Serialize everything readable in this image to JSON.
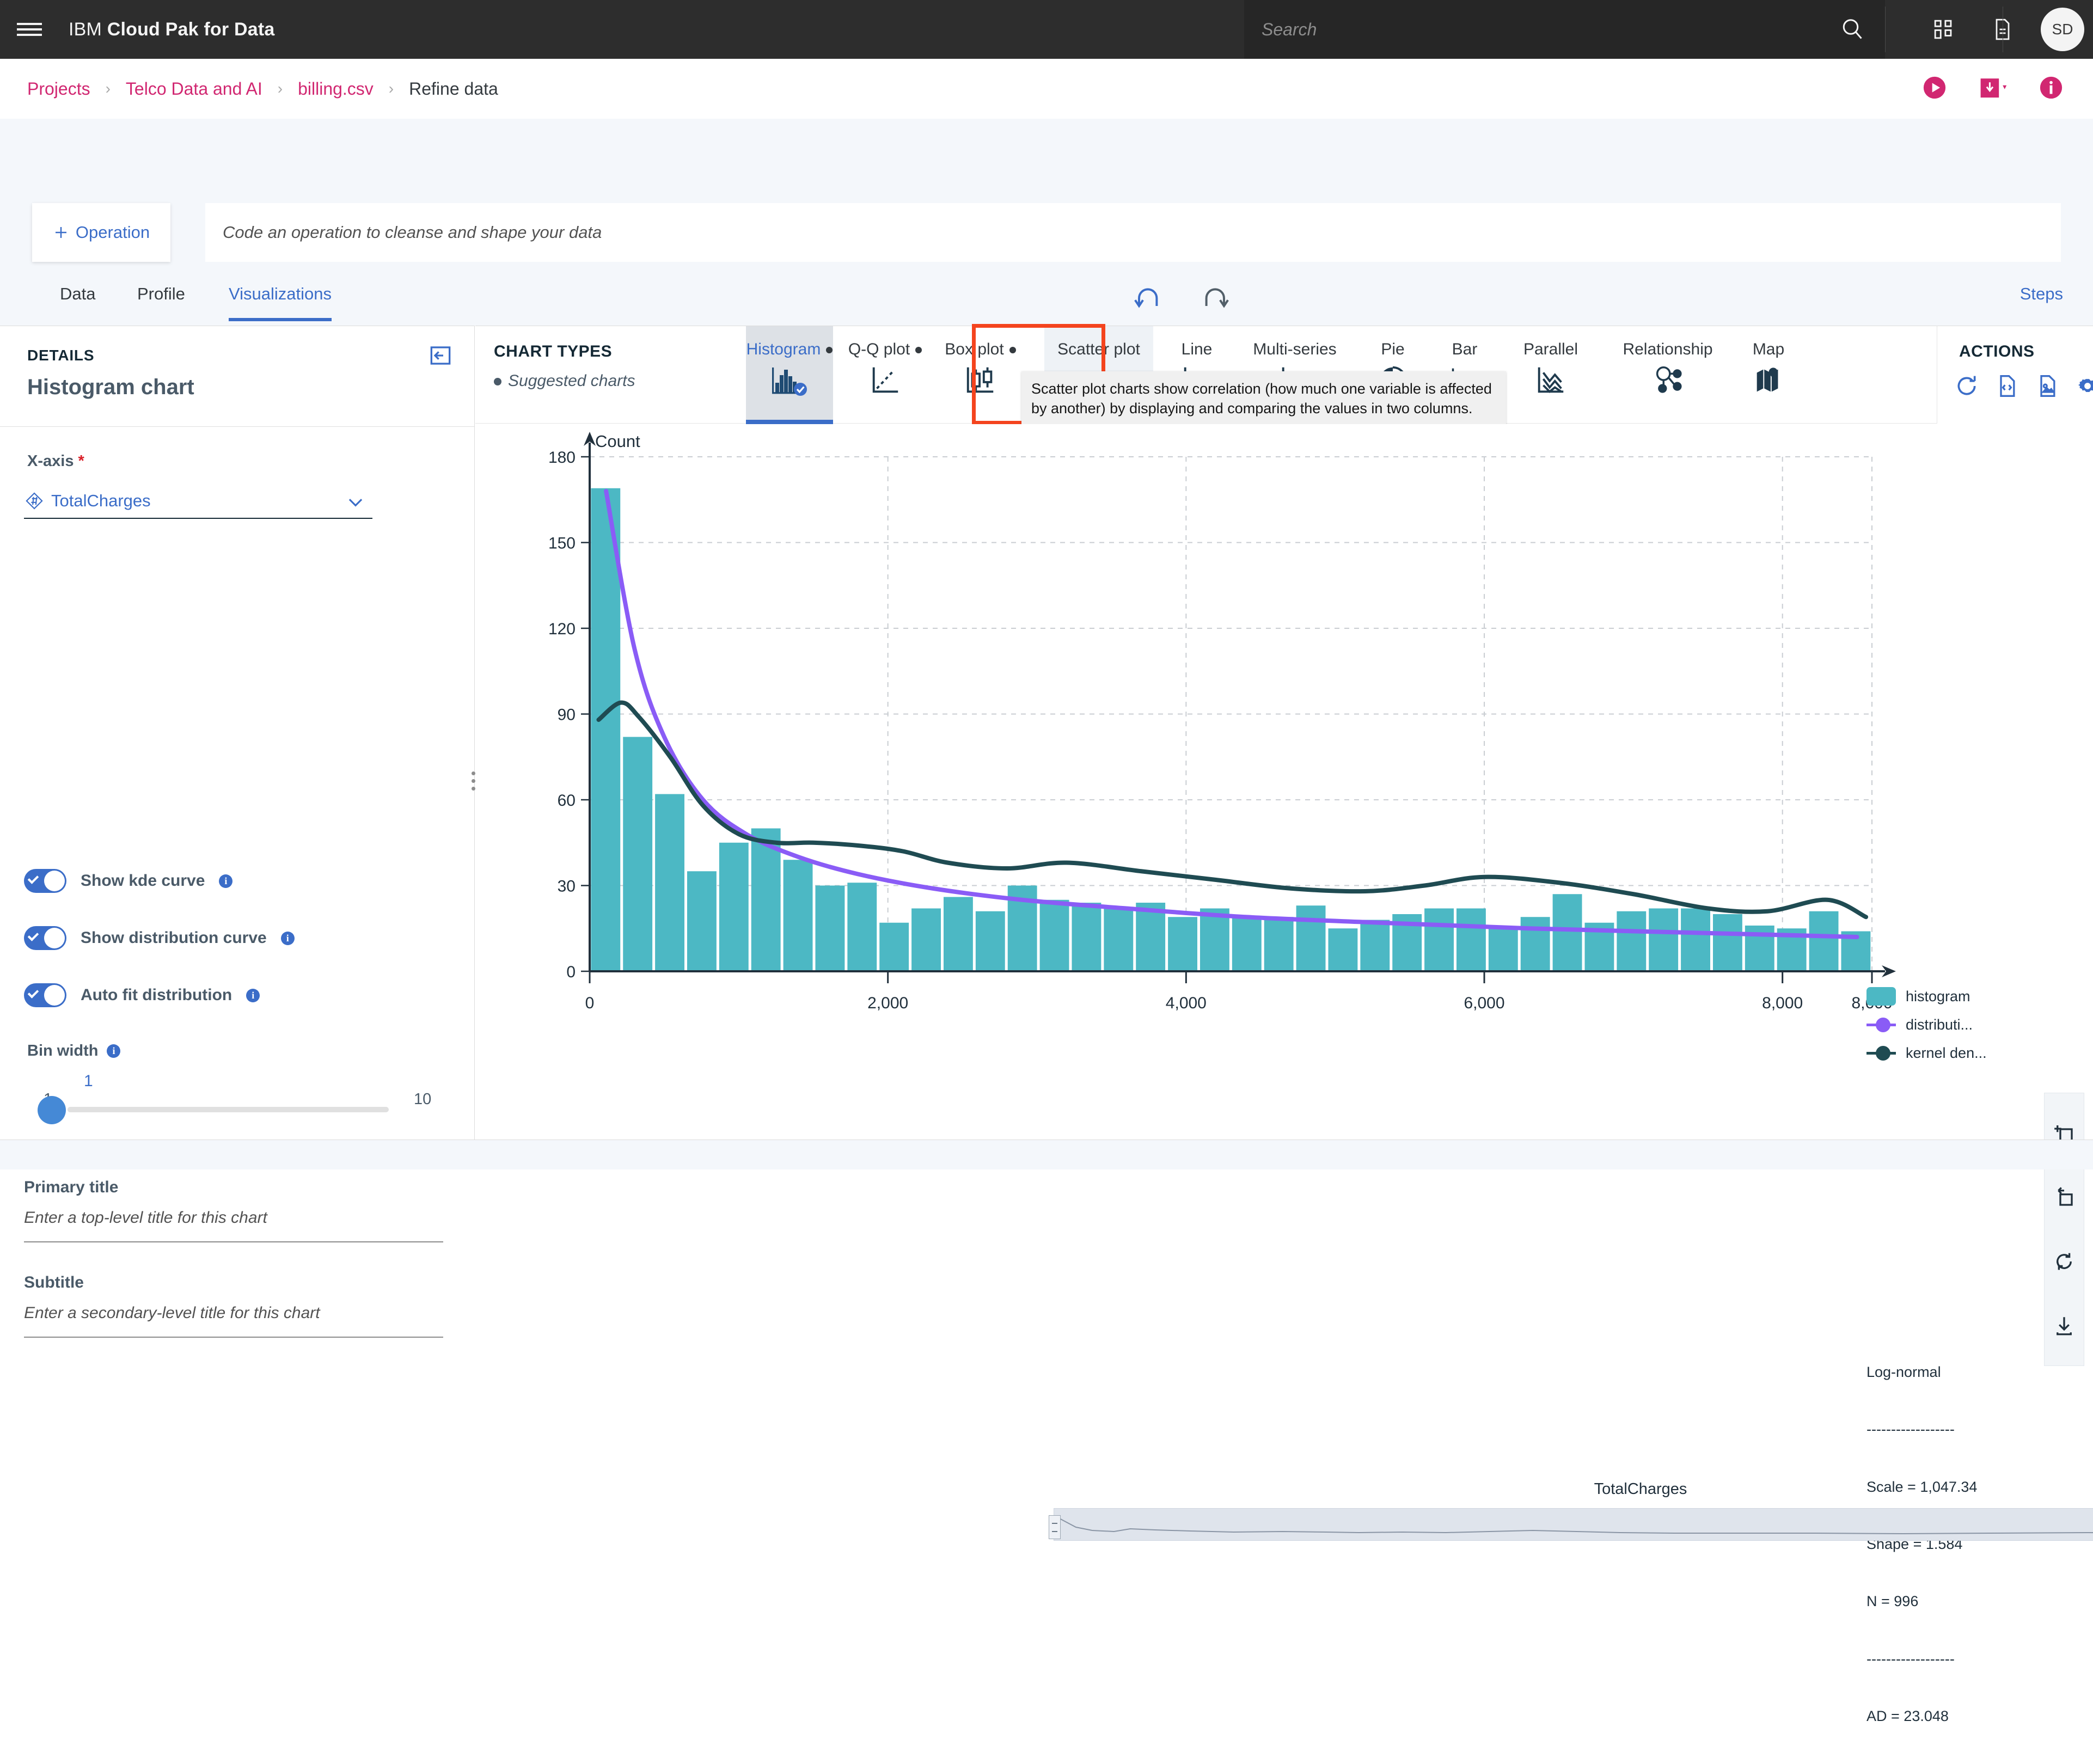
{
  "topbar": {
    "brand_prefix": "IBM",
    "brand_name": "Cloud Pak for Data",
    "search_placeholder": "Search",
    "avatar_initials": "SD",
    "icons": [
      "menu-icon",
      "search-icon",
      "apps-grid-icon",
      "document-icon"
    ]
  },
  "breadcrumb": {
    "items": [
      "Projects",
      "Telco Data and AI",
      "billing.csv",
      "Refine data"
    ],
    "separator": "›",
    "actions": [
      "run-icon",
      "save-dropdown-icon",
      "info-icon"
    ]
  },
  "operation": {
    "add_label": "Operation",
    "code_placeholder": "Code an operation to cleanse and shape your data"
  },
  "tabs": {
    "items": [
      "Data",
      "Profile",
      "Visualizations"
    ],
    "active": "Visualizations",
    "steps_label": "Steps",
    "undo_label": "undo-icon",
    "redo_label": "redo-icon"
  },
  "details": {
    "header_kicker": "DETAILS",
    "title": "Histogram chart",
    "collapse_icon": "collapse-panel-icon",
    "xaxis_label": "X-axis",
    "xaxis_required": "*",
    "xaxis_value": "TotalCharges",
    "toggles": [
      {
        "label": "Show kde curve",
        "on": true
      },
      {
        "label": "Show distribution curve",
        "on": true
      },
      {
        "label": "Auto fit distribution",
        "on": true
      }
    ],
    "bin_width_label": "Bin width",
    "bin_width_min": "1",
    "bin_width_max": "10",
    "bin_width_value": "1",
    "primary_title_label": "Primary title",
    "primary_title_placeholder": "Enter a top-level title for this chart",
    "subtitle_label": "Subtitle",
    "subtitle_placeholder": "Enter a secondary-level title for this chart"
  },
  "chart_types": {
    "title": "CHART TYPES",
    "suggested_label": "Suggested charts",
    "items": [
      {
        "label": "Histogram",
        "suggested": true,
        "state": "selected"
      },
      {
        "label": "Q-Q plot",
        "suggested": true,
        "state": "normal"
      },
      {
        "label": "Box plot",
        "suggested": true,
        "state": "normal"
      },
      {
        "label": "Scatter plot",
        "suggested": false,
        "state": "highlighted"
      },
      {
        "label": "Line",
        "suggested": false,
        "state": "normal"
      },
      {
        "label": "Multi-series",
        "suggested": false,
        "state": "normal"
      },
      {
        "label": "Pie",
        "suggested": false,
        "state": "normal"
      },
      {
        "label": "Bar",
        "suggested": false,
        "state": "normal"
      },
      {
        "label": "Parallel",
        "suggested": false,
        "state": "normal"
      },
      {
        "label": "Relationship",
        "suggested": false,
        "state": "normal"
      },
      {
        "label": "Map",
        "suggested": false,
        "state": "normal"
      }
    ],
    "overflow_icon": "chevron-double-down-icon",
    "tooltip": "Scatter plot charts show correlation (how much one variable is affected by another) by displaying and comparing the values in two columns."
  },
  "actions": {
    "title": "ACTIONS",
    "icons": [
      "refresh-icon",
      "code-file-icon",
      "image-file-icon",
      "gear-icon"
    ]
  },
  "side_tools": {
    "icons": [
      "add-selection-icon",
      "undo-selection-icon",
      "reset-zoom-icon",
      "download-icon"
    ]
  },
  "chart_data": {
    "type": "bar",
    "title": "",
    "xlabel": "TotalCharges",
    "ylabel": "Count",
    "xlim": [
      0,
      8600
    ],
    "ylim": [
      0,
      180
    ],
    "yticks": [
      0,
      30,
      60,
      90,
      120,
      150,
      180
    ],
    "xticks": [
      0,
      2000,
      4000,
      6000,
      8000,
      8600
    ],
    "xticklabels": [
      "0",
      "2,000",
      "4,000",
      "6,000",
      "8,000",
      "8,600"
    ],
    "grid": true,
    "legend_position": "right",
    "legend": [
      "histogram",
      "distributi...",
      "kernel den..."
    ],
    "colors": {
      "histogram": "#4cb8c4",
      "distribution": "#8a5cf6",
      "kde": "#1f4b52"
    },
    "bin_width": 215,
    "bin_centers": [
      107,
      322,
      537,
      752,
      967,
      1182,
      1397,
      1612,
      1827,
      2042,
      2257,
      2472,
      2687,
      2902,
      3117,
      3332,
      3547,
      3762,
      3977,
      4192,
      4407,
      4622,
      4837,
      5052,
      5267,
      5482,
      5697,
      5912,
      6127,
      6342,
      6557,
      6772,
      6987,
      7202,
      7417,
      7632,
      7847,
      8062,
      8277,
      8492
    ],
    "values": [
      169,
      82,
      62,
      35,
      45,
      50,
      39,
      30,
      31,
      17,
      22,
      26,
      21,
      30,
      25,
      24,
      22,
      24,
      19,
      22,
      19,
      19,
      23,
      15,
      18,
      20,
      22,
      22,
      15,
      19,
      27,
      17,
      21,
      22,
      22,
      20,
      16,
      15,
      21,
      14
    ],
    "series": [
      {
        "name": "distribution",
        "type": "line",
        "x": [
          110,
          300,
          500,
          760,
          1050,
          1400,
          1800,
          2300,
          2900,
          3600,
          4400,
          5300,
          6300,
          7400,
          8500
        ],
        "y": [
          168,
          113,
          82,
          60,
          48,
          40,
          34,
          29,
          25,
          22,
          19,
          17,
          15,
          13.5,
          12
        ]
      },
      {
        "name": "kernel density",
        "type": "line",
        "x": [
          60,
          210,
          330,
          540,
          760,
          1000,
          1250,
          1500,
          1800,
          2100,
          2400,
          2800,
          3200,
          3700,
          4200,
          4700,
          5200,
          5600,
          6000,
          6500,
          7000,
          7500,
          7900,
          8300,
          8560
        ],
        "y": [
          88,
          94,
          89,
          75,
          58,
          48,
          45,
          45,
          44,
          42,
          38,
          36,
          38,
          35,
          32,
          29,
          28,
          30,
          33,
          31,
          27,
          22,
          21,
          25,
          19
        ]
      }
    ],
    "stats": {
      "distribution": "Log-normal",
      "divider": "------------------",
      "scale_label": "Scale",
      "scale_value": "1,047.34",
      "shape_label": "Shape",
      "shape_value": "1.584",
      "n_label": "N",
      "n_value": "996",
      "ad_label": "AD",
      "ad_value": "23.048"
    }
  }
}
